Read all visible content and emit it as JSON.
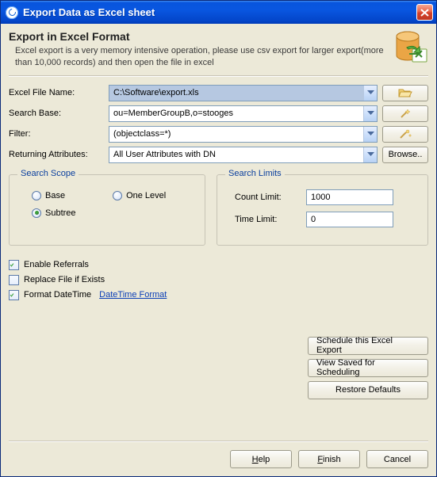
{
  "window": {
    "title": "Export Data as Excel sheet",
    "close": "Close"
  },
  "header": {
    "heading": "Export in Excel Format",
    "description": "Excel export is a very memory intensive operation, please use csv export for larger export(more than 10,000 records) and then open the file in excel"
  },
  "form": {
    "file_label": "Excel File Name:",
    "file_value": "C:\\Software\\export.xls",
    "base_label": "Search Base:",
    "base_value": "ou=MemberGroupB,o=stooges",
    "filter_label": "Filter:",
    "filter_value": "(objectclass=*)",
    "attrs_label": "Returning Attributes:",
    "attrs_value": "All User Attributes with DN",
    "browse_btn": "Browse.."
  },
  "scope": {
    "legend": "Search Scope",
    "base": "Base",
    "one_level": "One Level",
    "subtree": "Subtree",
    "selected": "subtree"
  },
  "limits": {
    "legend": "Search Limits",
    "count_label": "Count Limit:",
    "count_value": "1000",
    "time_label": "Time Limit:",
    "time_value": "0"
  },
  "options": {
    "enable_referrals": "Enable Referrals",
    "enable_referrals_checked": true,
    "replace_file": "Replace File if Exists",
    "replace_file_checked": false,
    "format_datetime": "Format DateTime",
    "format_datetime_checked": true,
    "datetime_link": "DateTime Format"
  },
  "right_buttons": {
    "schedule": "Schedule this Excel Export",
    "view_saved": "View Saved for Scheduling",
    "restore": "Restore Defaults"
  },
  "footer": {
    "help": "Help",
    "finish": "Finish",
    "cancel": "Cancel"
  }
}
